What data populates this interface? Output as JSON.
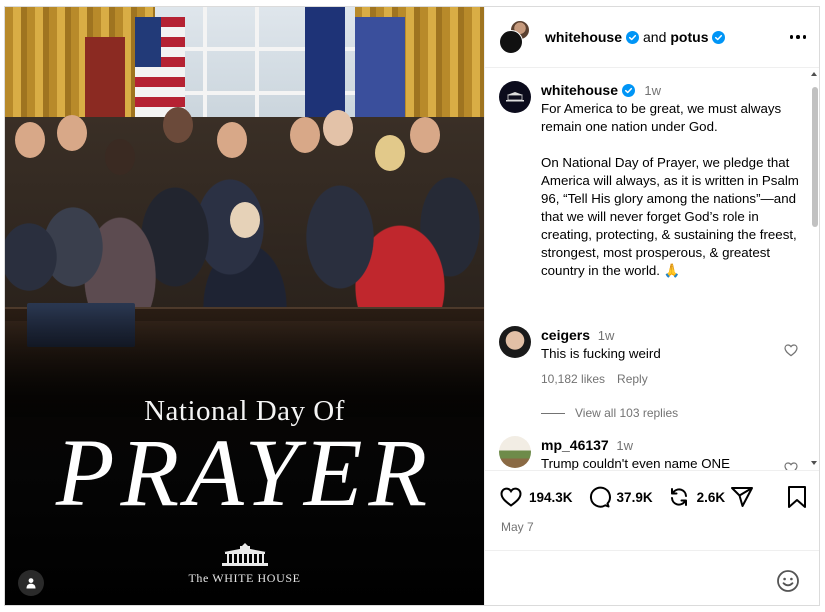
{
  "header": {
    "user1": "whitehouse",
    "joiner": "and",
    "user2": "potus"
  },
  "poster": {
    "subtitle": "National Day Of",
    "title": "PRAYER",
    "brand": "The WHITE HOUSE"
  },
  "caption": {
    "username": "whitehouse",
    "time": "1w",
    "paragraph1": "For America to be great, we must always remain one nation under God.",
    "paragraph2": "On National Day of Prayer, we pledge that America will always, as it is written in Psalm 96, “Tell His glory among the nations”—and that we will never forget God’s role in creating, protecting, & sustaining the freest, strongest, most prosperous, & greatest country in the world. 🙏"
  },
  "comments": [
    {
      "username": "ceigers",
      "time": "1w",
      "text": "This is fucking weird",
      "likes": "10,182 likes",
      "reply_label": "Reply",
      "view_replies": "View all 103 replies"
    },
    {
      "username": "mp_46137",
      "time": "1w",
      "text": "Trump couldn't even name ONE"
    }
  ],
  "actions": {
    "likes": "194.3K",
    "comments": "37.9K",
    "reposts": "2.6K",
    "date": "May 7"
  },
  "colors": {
    "verified": "#0095f6",
    "secondary_text": "#737373",
    "divider": "#efefef"
  }
}
